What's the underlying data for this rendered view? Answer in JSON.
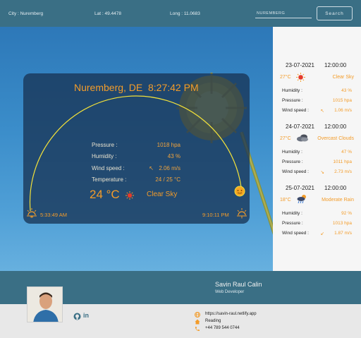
{
  "header": {
    "city_label": "City : Nuremberg",
    "lat_label": "Lat : 49.4478",
    "long_label": "Long : 11.0683",
    "search_placeholder": "NUREMBERG",
    "search_button": "Search"
  },
  "current": {
    "location": "Nuremberg, DE",
    "time": "8:27:42 PM",
    "pressure_label": "Pressure :",
    "pressure_value": "1018 hpa",
    "humidity_label": "Humidity :",
    "humidity_value": "43 %",
    "wind_label": "Wind speed :",
    "wind_arrow": "↖",
    "wind_value": "2.06 m/s",
    "temperature_label": "Temperature :",
    "temperature_value": "24 / 25 °C",
    "temp_big": "24 °C",
    "sky": "Clear Sky",
    "sunrise": "5:33:49 AM",
    "sunset": "9:10:11 PM",
    "accent": "#f39c2a"
  },
  "forecast": [
    {
      "date": "23-07-2021",
      "hour": "12:00:00",
      "temp": "27°C",
      "icon": "sun-icon",
      "desc": "Clear Sky",
      "humidity_label": "Humidity :",
      "humidity": "43 %",
      "pressure_label": "Pressure :",
      "pressure": "1015 hpa",
      "wind_label": "Wind speed :",
      "wind_arrow": "↖",
      "wind": "1.06 m/s"
    },
    {
      "date": "24-07-2021",
      "hour": "12:00:00",
      "temp": "27°C",
      "icon": "overcast-cloud-icon",
      "desc": "Overcast Clouds",
      "humidity_label": "Humidity :",
      "humidity": "47 %",
      "pressure_label": "Pressure :",
      "pressure": "1011 hpa",
      "wind_label": "Wind speed :",
      "wind_arrow": "↘",
      "wind": "2.73 m/s"
    },
    {
      "date": "25-07-2021",
      "hour": "12:00:00",
      "temp": "18°C",
      "icon": "rain-sun-icon",
      "desc": "Moderate Rain",
      "humidity_label": "Humidity :",
      "humidity": "92 %",
      "pressure_label": "Pressure :",
      "pressure": "1013 hpa",
      "wind_label": "Wind speed :",
      "wind_arrow": "↙",
      "wind": "1.87 m/s"
    }
  ],
  "footer": {
    "name": "Savin Raul Calin",
    "role": "Web Developer",
    "website": "https://savin-raul.netlify.app",
    "location": "Reading",
    "phone": "+44 789 544 0744",
    "github_icon": "github-icon",
    "linkedin_text": "in"
  }
}
